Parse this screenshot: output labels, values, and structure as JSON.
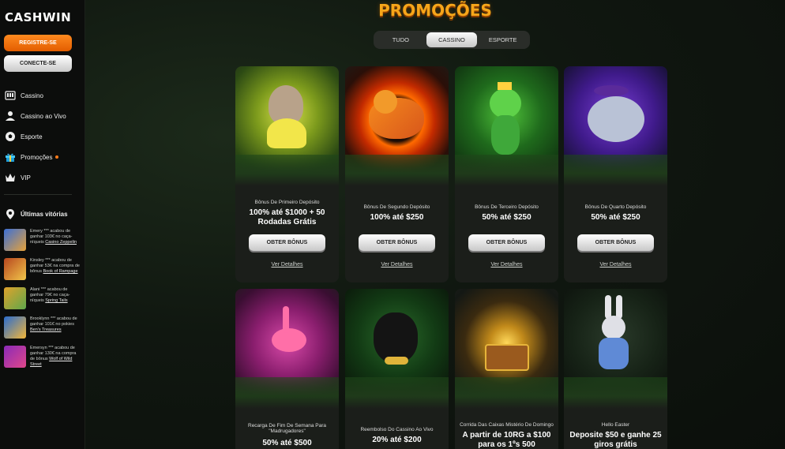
{
  "brand": {
    "logo": "CASHWIN"
  },
  "auth": {
    "register": "REGISTRE-SE",
    "login": "CONECTE-SE"
  },
  "nav": [
    {
      "label": "Cassino",
      "icon": "slot-machine-icon"
    },
    {
      "label": "Cassino ao Vivo",
      "icon": "dealer-icon"
    },
    {
      "label": "Esporte",
      "icon": "soccer-ball-icon"
    },
    {
      "label": "Promoções",
      "icon": "gift-icon",
      "badge": true
    },
    {
      "label": "VIP",
      "icon": "crown-icon"
    }
  ],
  "recent_wins": {
    "title": "Últimas vitórias",
    "items": [
      {
        "text": "Emery *** acabou de ganhar 103€ no caça-níqueis ",
        "game": "Casino Zeppelin"
      },
      {
        "text": "Kinsley *** acabou de ganhar 53€ na compra de bônus ",
        "game": "Book of Rampage"
      },
      {
        "text": "Alani *** acabou de ganhar 79€ no caça-níqueis ",
        "game": "Spring Tails"
      },
      {
        "text": "Brooklynn *** acabou de ganhar 101€ no pokies ",
        "game": "Ben's Treasures"
      },
      {
        "text": "Emersyn *** acabou de ganhar 130€ na compra de bônus ",
        "game": "Wolf of Wild Street"
      }
    ]
  },
  "page": {
    "title": "PROMOÇÕES"
  },
  "tabs": [
    {
      "label": "TUDO",
      "active": false
    },
    {
      "label": "CASSINO",
      "active": true
    },
    {
      "label": "ESPORTE",
      "active": false
    }
  ],
  "promos": [
    {
      "subtitle": "Bônus De Primeiro Depósito",
      "headline": "100% até $1000 + 50 Rodadas Grátis",
      "button": "OBTER BÔNUS",
      "link": "Ver Detalhes",
      "art": "hippo"
    },
    {
      "subtitle": "Bônus De Segundo Depósito",
      "headline": "100% até $250",
      "button": "OBTER BÔNUS",
      "link": "Ver Detalhes",
      "art": "tiger"
    },
    {
      "subtitle": "Bônus De Terceiro Depósito",
      "headline": "50% até $250",
      "button": "OBTER BÔNUS",
      "link": "Ver Detalhes",
      "art": "frog"
    },
    {
      "subtitle": "Bônus De Quarto Depósito",
      "headline": "50% até $250",
      "button": "OBTER BÔNUS",
      "link": "Ver Detalhes",
      "art": "elephant"
    },
    {
      "subtitle": "Recarga De Fim De Semana Para \"Madrugadores\"",
      "headline": "50% até $500",
      "art": "flamingo"
    },
    {
      "subtitle": "Reembolso Do Cassino Ao Vivo",
      "headline": "20% até $200",
      "art": "panther"
    },
    {
      "subtitle": "Corrida Das Caixas Mistério De Domingo",
      "headline": "A partir de 10RG a $100 para os 1ºs 500",
      "art": "chest"
    },
    {
      "subtitle": "Hello Easter",
      "headline": "Deposite $50 e ganhe 25 giros grátis",
      "art": "bunny"
    }
  ],
  "colors": {
    "accent": "#ff7a1a",
    "title": "#f6a61a"
  }
}
